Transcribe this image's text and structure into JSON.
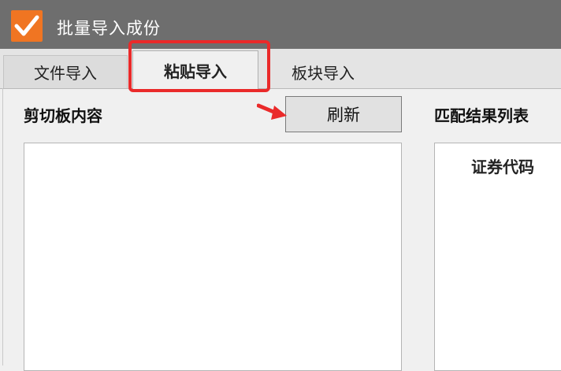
{
  "window": {
    "title": "批量导入成份",
    "icon": "checkmark-icon",
    "colors": {
      "titlebar": "#6e6e6e",
      "icon_bg": "#f07522",
      "highlight": "#ea2a2a"
    }
  },
  "tabs": [
    {
      "label": "文件导入",
      "active": false
    },
    {
      "label": "粘贴导入",
      "active": true
    },
    {
      "label": "板块导入",
      "active": false
    }
  ],
  "clipboard": {
    "label": "剪切板内容",
    "value": ""
  },
  "toolbar": {
    "refresh_label": "刷新"
  },
  "results": {
    "label": "匹配结果列表",
    "columns": [
      "证券代码"
    ]
  }
}
